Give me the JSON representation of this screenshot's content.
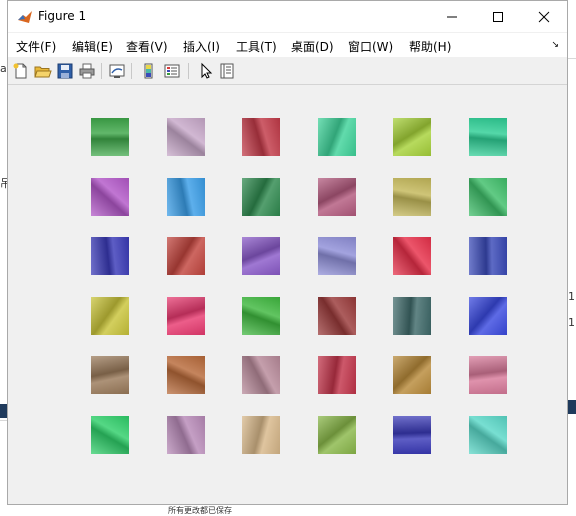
{
  "window": {
    "title": "Figure 1",
    "minimize_glyph": "—",
    "maximize_glyph": "☐",
    "close_glyph": "✕"
  },
  "menu": [
    {
      "label": "文件(F)",
      "name": "menu-file"
    },
    {
      "label": "编辑(E)",
      "name": "menu-edit"
    },
    {
      "label": "查看(V)",
      "name": "menu-view"
    },
    {
      "label": "插入(I)",
      "name": "menu-insert"
    },
    {
      "label": "工具(T)",
      "name": "menu-tools"
    },
    {
      "label": "桌面(D)",
      "name": "menu-desktop"
    },
    {
      "label": "窗口(W)",
      "name": "menu-window"
    },
    {
      "label": "帮助(H)",
      "name": "menu-help"
    }
  ],
  "menu_dock_arrow": "↘",
  "toolbar": [
    {
      "icon": "new-figure-icon"
    },
    {
      "icon": "open-file-icon"
    },
    {
      "icon": "save-icon"
    },
    {
      "icon": "print-icon"
    },
    {
      "icon": "link-plot-icon"
    },
    {
      "icon": "insert-colorbar-icon"
    },
    {
      "icon": "insert-legend-icon"
    },
    {
      "icon": "edit-plot-arrow-icon"
    },
    {
      "icon": "property-inspector-icon"
    }
  ],
  "background_app": {
    "left_fragments": [
      "ale",
      "吊"
    ],
    "right_fragments": [
      "1.2",
      "1.2"
    ],
    "bottom_text": "所有更改都已保存"
  },
  "filter_grid": {
    "rows": 6,
    "cols": 6,
    "tiles": [
      [
        "#3fa84a",
        "#c7a8c9",
        "#c23a48",
        "#3fd39a",
        "#a7d23a",
        "#2fcf96"
      ],
      [
        "#b358c9",
        "#3a9ee8",
        "#2f8a4f",
        "#b35a7e",
        "#c4b85a",
        "#3fbf6a"
      ],
      [
        "#3a3ab8",
        "#c2453e",
        "#8a5ac9",
        "#8f8fd8",
        "#e8304a",
        "#3a4ab8"
      ],
      [
        "#c9c43a",
        "#e83a70",
        "#3fb83f",
        "#9a3a3a",
        "#3f6a6a",
        "#3a4ae0"
      ],
      [
        "#9a7a5a",
        "#b86a3a",
        "#b88a9a",
        "#c2344a",
        "#b88a3a",
        "#d87a9a"
      ],
      [
        "#2fcf6a",
        "#b88ab8",
        "#d8b88a",
        "#8ab84a",
        "#3a3ab8",
        "#5ad8c8"
      ]
    ]
  }
}
